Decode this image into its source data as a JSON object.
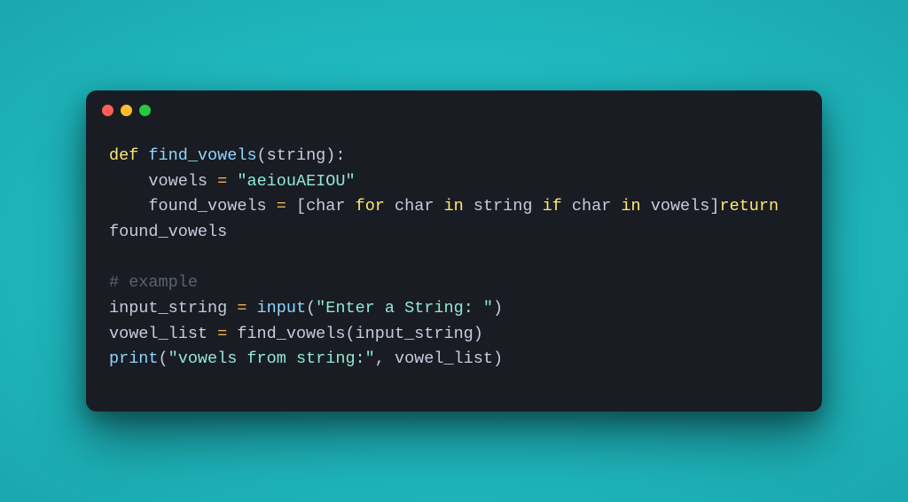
{
  "window": {
    "traffic_lights": [
      "red",
      "yellow",
      "green"
    ]
  },
  "code": {
    "tokens": [
      {
        "t": "def ",
        "c": "kw"
      },
      {
        "t": "find_vowels",
        "c": "fn"
      },
      {
        "t": "(",
        "c": "punct"
      },
      {
        "t": "string",
        "c": "var"
      },
      {
        "t": "):",
        "c": "punct"
      },
      {
        "t": "\n"
      },
      {
        "t": "    vowels ",
        "c": "var"
      },
      {
        "t": "=",
        "c": "op"
      },
      {
        "t": " ",
        "c": "var"
      },
      {
        "t": "\"aeiouAEIOU\"",
        "c": "str"
      },
      {
        "t": "\n"
      },
      {
        "t": "    found_vowels ",
        "c": "var"
      },
      {
        "t": "=",
        "c": "op"
      },
      {
        "t": " [",
        "c": "punct"
      },
      {
        "t": "char ",
        "c": "var"
      },
      {
        "t": "for",
        "c": "kw"
      },
      {
        "t": " char ",
        "c": "var"
      },
      {
        "t": "in",
        "c": "kw"
      },
      {
        "t": " string ",
        "c": "var"
      },
      {
        "t": "if",
        "c": "kw"
      },
      {
        "t": " char ",
        "c": "var"
      },
      {
        "t": "in",
        "c": "kw"
      },
      {
        "t": " vowels]",
        "c": "var"
      },
      {
        "t": "return",
        "c": "kw"
      },
      {
        "t": " found_vowels",
        "c": "var"
      },
      {
        "t": "\n"
      },
      {
        "t": "\n"
      },
      {
        "t": "# example",
        "c": "comment"
      },
      {
        "t": "\n"
      },
      {
        "t": "input_string ",
        "c": "var"
      },
      {
        "t": "=",
        "c": "op"
      },
      {
        "t": " ",
        "c": "var"
      },
      {
        "t": "input",
        "c": "builtin"
      },
      {
        "t": "(",
        "c": "punct"
      },
      {
        "t": "\"Enter a String: \"",
        "c": "str"
      },
      {
        "t": ")",
        "c": "punct"
      },
      {
        "t": "\n"
      },
      {
        "t": "vowel_list ",
        "c": "var"
      },
      {
        "t": "=",
        "c": "op"
      },
      {
        "t": " find_vowels(input_string)",
        "c": "var"
      },
      {
        "t": "\n"
      },
      {
        "t": "print",
        "c": "builtin"
      },
      {
        "t": "(",
        "c": "punct"
      },
      {
        "t": "\"vowels from string:\"",
        "c": "str"
      },
      {
        "t": ", vowel_list)",
        "c": "var"
      }
    ]
  }
}
